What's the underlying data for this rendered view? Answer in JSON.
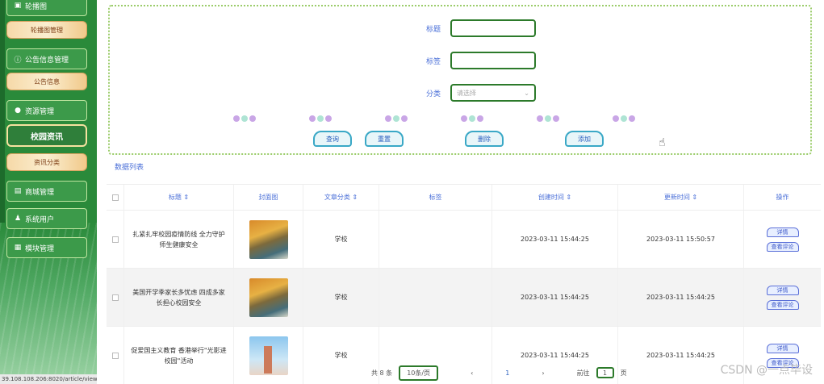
{
  "sidebar": {
    "items": [
      {
        "label": "轮播图",
        "icon": "image-icon",
        "type": "menu"
      },
      {
        "label": "轮播图管理",
        "type": "submenu"
      },
      {
        "label": "公告信息管理",
        "icon": "info-circle-icon",
        "type": "menu"
      },
      {
        "label": "公告信息",
        "type": "submenu"
      },
      {
        "label": "资源管理",
        "icon": "lightbulb-icon",
        "type": "menu"
      },
      {
        "label": "校园资讯",
        "type": "submenu-active"
      },
      {
        "label": "资讯分类",
        "type": "submenu"
      },
      {
        "label": "商城管理",
        "icon": "shop-icon",
        "type": "menu"
      },
      {
        "label": "系统用户",
        "icon": "user-icon",
        "type": "menu"
      },
      {
        "label": "模块管理",
        "icon": "grid-icon",
        "type": "menu"
      }
    ],
    "status_url": "39.108.108.206:8020/article/view"
  },
  "search": {
    "title_label": "标题",
    "tag_label": "标签",
    "category_label": "分类",
    "category_placeholder": "请选择",
    "buttons": {
      "query": "查询",
      "reset": "重置",
      "delete": "删除",
      "add": "添加"
    }
  },
  "list_title": "数据列表",
  "table": {
    "headers": [
      "标题",
      "封面图",
      "文章分类",
      "标签",
      "创建时间",
      "更新时间",
      "操作"
    ],
    "rows": [
      {
        "title": "扎紧扎牢校园疫情防线 全力守护师生健康安全",
        "category": "学校",
        "tag": "",
        "created": "2023-03-11 15:44:25",
        "updated": "2023-03-11 15:50:57",
        "cover": "autumn"
      },
      {
        "title": "美国开学季家长多忧虑 四成多家长担心校园安全",
        "category": "学校",
        "tag": "",
        "created": "2023-03-11 15:44:25",
        "updated": "2023-03-11 15:44:25",
        "cover": "autumn"
      },
      {
        "title": "促爱国主义教育 香港举行\"光影进校园\"活动",
        "category": "学校",
        "tag": "",
        "created": "2023-03-11 15:44:25",
        "updated": "2023-03-11 15:44:25",
        "cover": "tower"
      }
    ],
    "op_detail": "详情",
    "op_comments": "查看评论"
  },
  "pagination": {
    "total": "共 8 条",
    "page_size": "10条/页",
    "prev": "‹",
    "current": "1",
    "next": "›",
    "goto_label": "前往",
    "goto_value": "1",
    "goto_suffix": "页"
  },
  "watermark": "CSDN @一点毕设"
}
